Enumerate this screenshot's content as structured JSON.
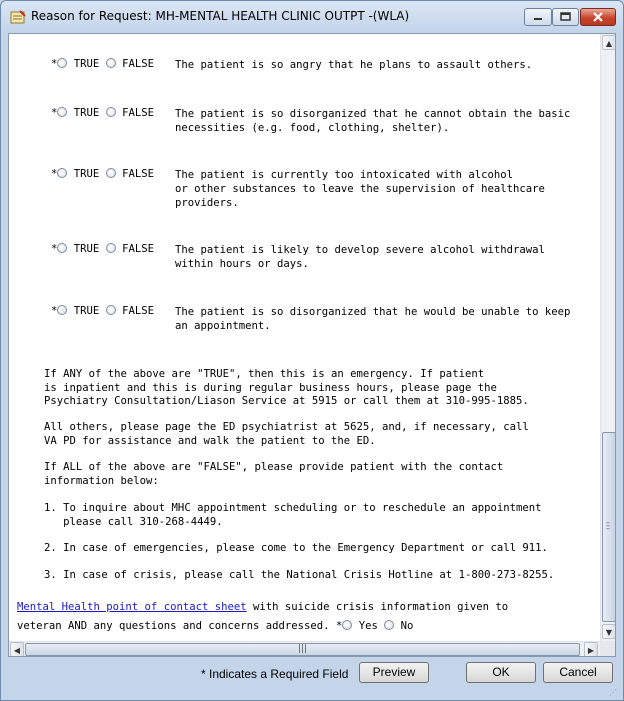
{
  "window": {
    "title": "Reason for Request: MH-MENTAL HEALTH CLINIC OUTPT -(WLA)"
  },
  "colors": {
    "link": "#1a1ac8",
    "close_button": "#c9442c"
  },
  "questions": [
    {
      "required_marker": "*",
      "true_label": "TRUE",
      "false_label": "FALSE",
      "text": "The patient is so angry that he plans to assault others."
    },
    {
      "required_marker": "*",
      "true_label": "TRUE",
      "false_label": "FALSE",
      "text": "The patient is so disorganized that he cannot obtain the basic\nnecessities (e.g. food, clothing, shelter)."
    },
    {
      "required_marker": "*",
      "true_label": "TRUE",
      "false_label": "FALSE",
      "text": "The patient is currently too intoxicated with alcohol\nor other substances to leave the supervision of healthcare\nproviders."
    },
    {
      "required_marker": "*",
      "true_label": "TRUE",
      "false_label": "FALSE",
      "text": "The patient is likely to develop severe alcohol withdrawal\nwithin hours or days."
    },
    {
      "required_marker": "*",
      "true_label": "TRUE",
      "false_label": "FALSE",
      "text": "The patient is so disorganized that he would be unable to keep\nan appointment."
    }
  ],
  "instructions": {
    "emergency": "If ANY of the above are \"TRUE\", then this is an emergency. If patient\nis inpatient and this is during regular business hours, please page the\nPsychiatry Consultation/Liason Service at 5915 or call them at 310-995-1885.",
    "others": "All others, please page the ED psychiatrist at 5625, and, if necessary, call\nVA PD for assistance and walk the patient to the ED.",
    "all_false": "If ALL of the above are \"FALSE\", please provide patient with the contact\ninformation below:",
    "item1": "1. To inquire about MHC appointment scheduling or to reschedule an appointment\n   please call 310-268-4449.",
    "item2": "2. In case of emergencies, please come to the Emergency Department or call 911.",
    "item3": "3. In case of crisis, please call the National Crisis Hotline at 1-800-273-8255."
  },
  "contact": {
    "link_text": "Mental Health point of contact sheet",
    "line1": " with suicide crisis information given to",
    "line2": "veteran AND any questions and concerns addressed.",
    "required_marker": "*",
    "yes_label": "Yes",
    "no_label": "No"
  },
  "footer": {
    "required_note": "* Indicates a Required Field",
    "preview_label": "Preview",
    "ok_label": "OK",
    "cancel_label": "Cancel"
  }
}
